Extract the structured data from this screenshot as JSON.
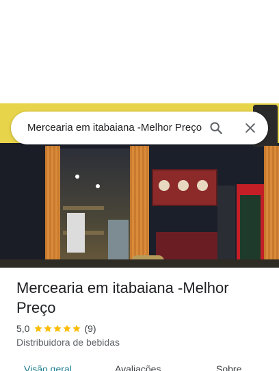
{
  "search": {
    "query": "Mercearia em itabaiana -Melhor Preço"
  },
  "place": {
    "name": "Mercearia em itabaiana -Melhor Preço",
    "rating": "5,0",
    "stars": 5,
    "review_count": "(9)",
    "category": "Distribuidora de bebidas"
  },
  "tabs": [
    {
      "label": "Visão geral"
    },
    {
      "label": "Avaliações"
    },
    {
      "label": "Sobre"
    }
  ],
  "colors": {
    "accent_tab": "#137a8a",
    "star": "#fbbc04"
  },
  "icons": [
    "search-icon",
    "close-icon",
    "star-icon"
  ]
}
